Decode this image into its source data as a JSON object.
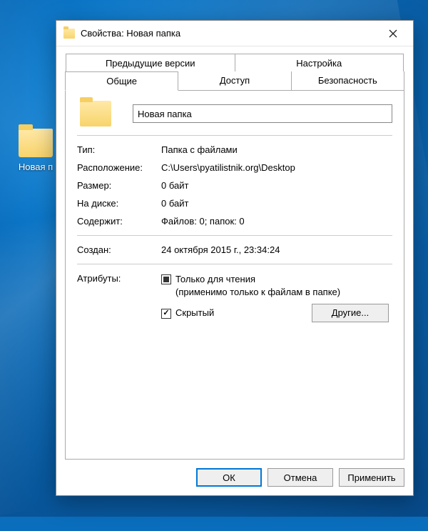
{
  "desktop": {
    "icon_label": "Новая п"
  },
  "dialog": {
    "title": "Свойства: Новая папка"
  },
  "tabs": {
    "back": [
      "Предыдущие версии",
      "Настройка"
    ],
    "front": [
      "Общие",
      "Доступ",
      "Безопасность"
    ],
    "active": "Общие"
  },
  "general": {
    "name": "Новая папка",
    "rows": {
      "type_label": "Тип:",
      "type_value": "Папка с файлами",
      "location_label": "Расположение:",
      "location_value": "C:\\Users\\pyatilistnik.org\\Desktop",
      "size_label": "Размер:",
      "size_value": "0 байт",
      "ondisk_label": "На диске:",
      "ondisk_value": "0 байт",
      "contains_label": "Содержит:",
      "contains_value": "Файлов: 0; папок: 0",
      "created_label": "Создан:",
      "created_value": "24 октября 2015 г., 23:34:24",
      "attributes_label": "Атрибуты:"
    },
    "attributes": {
      "readonly_label": "Только для чтения",
      "readonly_sub": "(применимо только к файлам в папке)",
      "readonly_state": "indeterminate",
      "hidden_label": "Скрытый",
      "hidden_state": "checked",
      "other_button": "Другие..."
    }
  },
  "footer": {
    "ok": "ОК",
    "cancel": "Отмена",
    "apply": "Применить"
  }
}
